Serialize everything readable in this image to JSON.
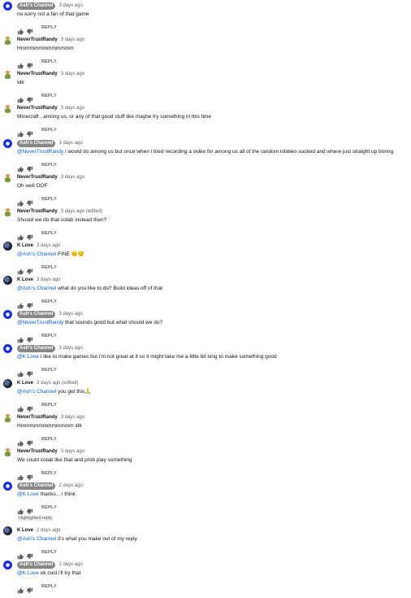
{
  "reply_label": "REPLY",
  "icons": {
    "like": "thumbs-up-icon",
    "dislike": "thumbs-down-icon"
  },
  "comments": [
    {
      "author": "Ash's Channel",
      "chip": true,
      "avatar": "ash",
      "time": "3 days ago",
      "mention": "",
      "text": "no sorry not a fan of that game"
    },
    {
      "author": "NeverTrustRandy",
      "chip": false,
      "avatar": "randy",
      "time": "3 days ago",
      "mention": "",
      "text": "Hmmmmmmmmmmmm"
    },
    {
      "author": "NeverTrustRandy",
      "chip": false,
      "avatar": "randy",
      "time": "3 days ago",
      "mention": "",
      "text": "Idk"
    },
    {
      "author": "NeverTrustRandy",
      "chip": false,
      "avatar": "randy",
      "time": "3 days ago",
      "mention": "",
      "text": "Minecraft , among us, or any of that good stuff like maybe try something irl this time"
    },
    {
      "author": "Ash's Channel",
      "chip": true,
      "avatar": "ash",
      "time": "3 days ago",
      "mention": "@NeverTrustRandy",
      "text": " i would do among us but once when i tried recording a video for among us all of the random lobbies sucked and where just straight up boring"
    },
    {
      "author": "NeverTrustRandy",
      "chip": false,
      "avatar": "randy",
      "time": "3 days ago",
      "mention": "",
      "text": "Oh well OOF"
    },
    {
      "author": "NeverTrustRandy",
      "chip": false,
      "avatar": "randy",
      "time": "3 days ago (edited)",
      "mention": "",
      "text": "Should we do that colab instead then?"
    },
    {
      "author": "K Love",
      "chip": false,
      "avatar": "klove",
      "time": "3 days ago",
      "mention": "@Ash's Channel",
      "text": " FINE  😑😏"
    },
    {
      "author": "K Love",
      "chip": false,
      "avatar": "klove",
      "time": "3 days ago",
      "mention": "@Ash's Channel",
      "text": " what do you like to do?  Build ideas off of that"
    },
    {
      "author": "Ash's Channel",
      "chip": true,
      "avatar": "ash",
      "time": "3 days ago",
      "mention": "@NeverTrustRandy",
      "text": " that sounds good but what should we do?"
    },
    {
      "author": "Ash's Channel",
      "chip": true,
      "avatar": "ash",
      "time": "3 days ago",
      "mention": "@K Love",
      "text": " I like to make games but i'm not great at it so it might take me a little bit long to make something good"
    },
    {
      "author": "K Love",
      "chip": false,
      "avatar": "klove",
      "time": "3 days ago (edited)",
      "mention": "@Ash's Channel",
      "text": " you get this🙏"
    },
    {
      "author": "NeverTrustRandy",
      "chip": false,
      "avatar": "randy",
      "time": "3 days ago",
      "mention": "",
      "text": "Hmmmmmmmmmmmm idk"
    },
    {
      "author": "NeverTrustRandy",
      "chip": false,
      "avatar": "randy",
      "time": "3 days ago",
      "mention": "",
      "text": "We could colab like that and prob play something"
    },
    {
      "author": "Ash's Channel",
      "chip": true,
      "avatar": "ash",
      "time": "2 days ago",
      "mention": "@K Love",
      "text": " thanks... i think"
    },
    {
      "author": "K Love",
      "chip": false,
      "avatar": "klove",
      "time": "2 days ago",
      "mention": "@Ash's Channel",
      "text": " it's what you make out of my reply",
      "highlight": "Highlighted reply"
    },
    {
      "author": "Ash's Channel",
      "chip": true,
      "avatar": "ash",
      "time": "2 days ago",
      "mention": "@K Love",
      "text": " ok cool i'll try that"
    }
  ]
}
